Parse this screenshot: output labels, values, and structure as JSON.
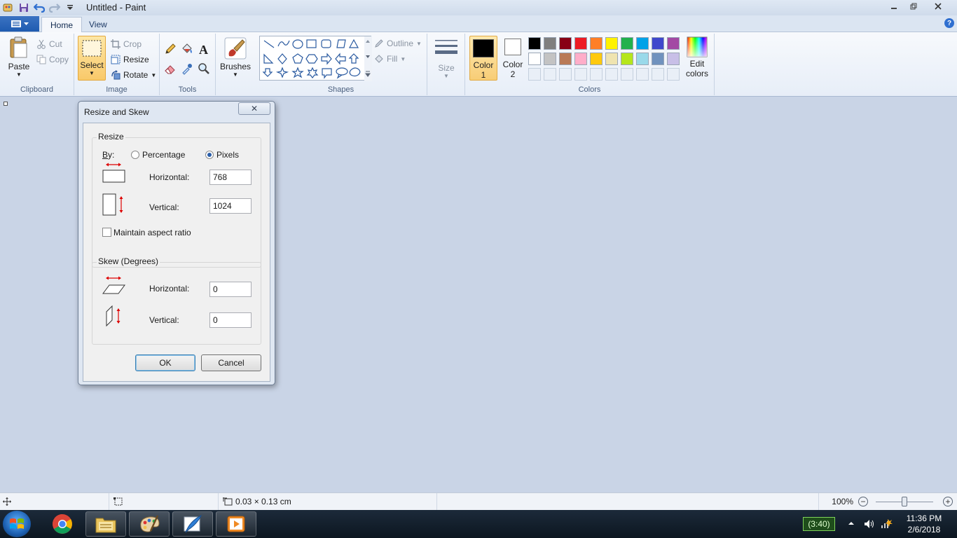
{
  "window": {
    "title": "Untitled - Paint"
  },
  "tabs": {
    "home": "Home",
    "view": "View"
  },
  "ribbon": {
    "clipboard": {
      "paste": "Paste",
      "cut": "Cut",
      "copy": "Copy",
      "label": "Clipboard"
    },
    "image": {
      "select": "Select",
      "crop": "Crop",
      "resize": "Resize",
      "rotate": "Rotate",
      "label": "Image"
    },
    "tools": {
      "label": "Tools"
    },
    "brushes": "Brushes",
    "shapes": {
      "outline": "Outline",
      "fill": "Fill",
      "label": "Shapes"
    },
    "size": "Size",
    "colors": {
      "color1_line1": "Color",
      "color1_line2": "1",
      "color2_line1": "Color",
      "color2_line2": "2",
      "edit_line1": "Edit",
      "edit_line2": "colors",
      "label": "Colors",
      "color1_value": "#000000",
      "color2_value": "#ffffff",
      "palette_row1": [
        "#000000",
        "#7f7f7f",
        "#880015",
        "#ed1c24",
        "#ff7f27",
        "#fff200",
        "#22b14c",
        "#00a2e8",
        "#3f48cc",
        "#a349a4"
      ],
      "palette_row2": [
        "#ffffff",
        "#c3c3c3",
        "#b97a57",
        "#ffaec9",
        "#ffc90e",
        "#efe4b0",
        "#b5e61d",
        "#99d9ea",
        "#7092be",
        "#c8bfe7"
      ]
    }
  },
  "dialog": {
    "title": "Resize and Skew",
    "close": "✕",
    "resize_group": "Resize",
    "by_label": "By:",
    "percentage": "Percentage",
    "pixels": "Pixels",
    "horizontal_label": "Horizontal:",
    "vertical_label": "Vertical:",
    "horizontal_value": "768",
    "vertical_value": "1024",
    "maintain_aspect": "Maintain aspect ratio",
    "skew_group": "Skew (Degrees)",
    "skew_horizontal_label": "Horizontal:",
    "skew_vertical_label": "Vertical:",
    "skew_horizontal_value": "0",
    "skew_vertical_value": "0",
    "ok": "OK",
    "cancel": "Cancel"
  },
  "statusbar": {
    "selection_size": "0.03 × 0.13 cm",
    "zoom": "100%",
    "zoom_level": 0.5
  },
  "taskbar": {
    "battery": "(3:40)",
    "time": "11:36 PM",
    "date": "2/6/2018"
  }
}
